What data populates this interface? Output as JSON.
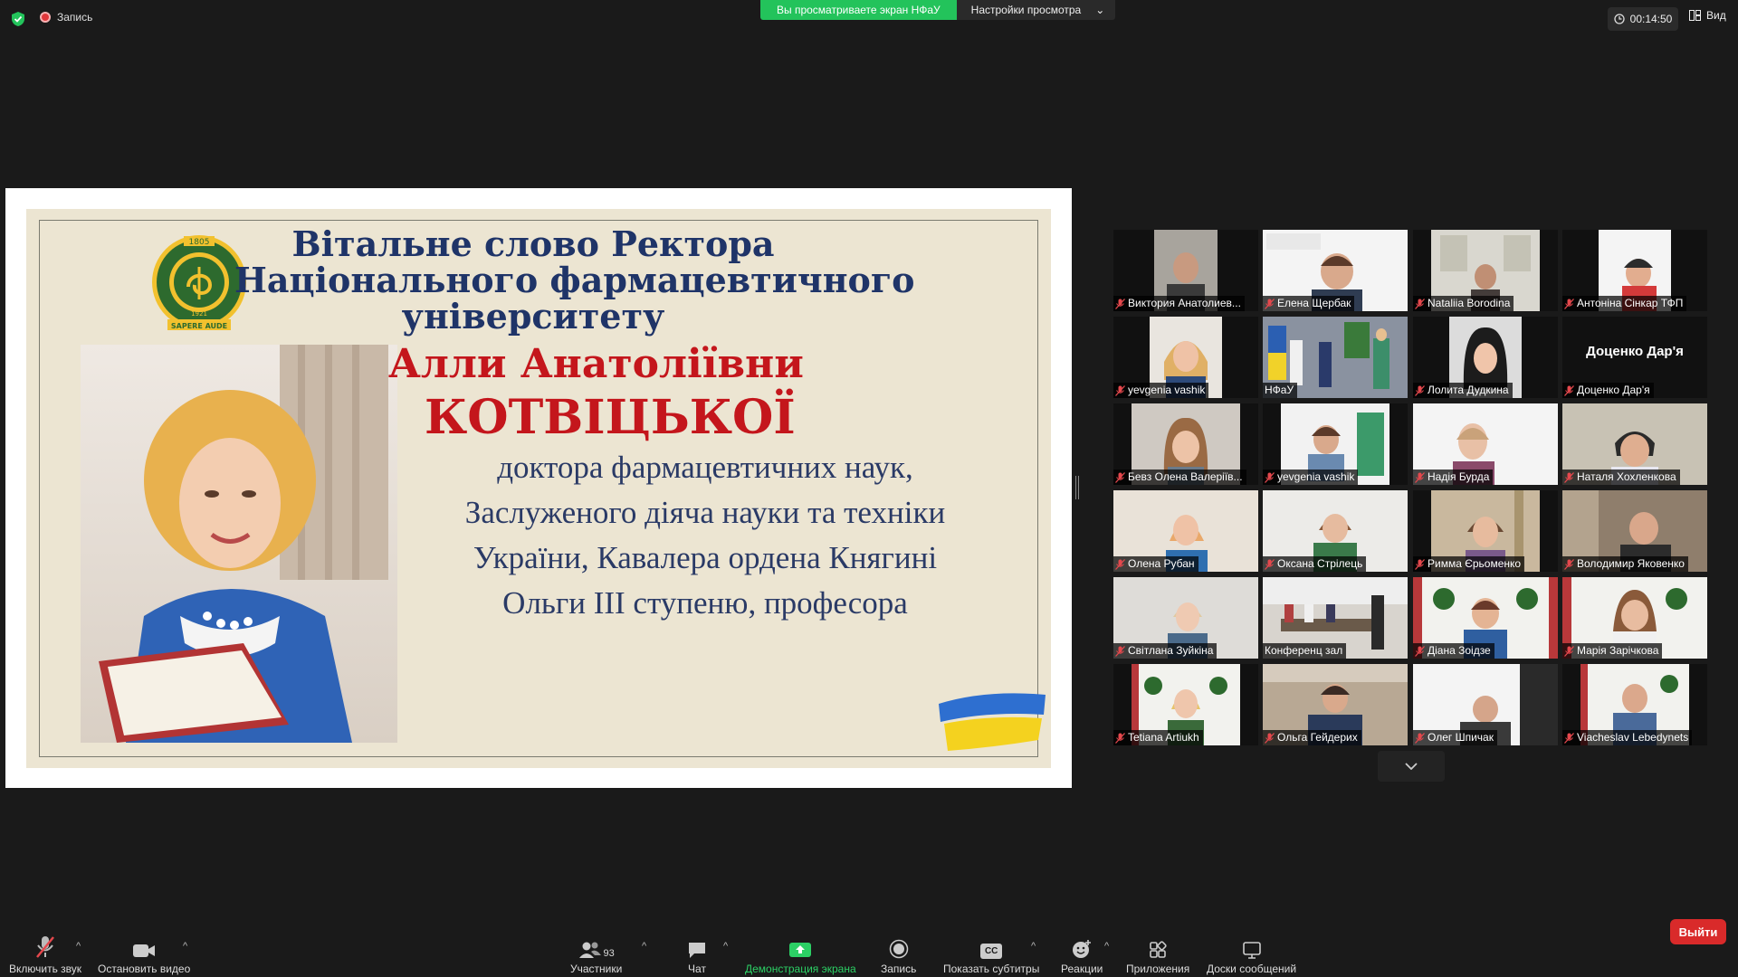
{
  "top": {
    "recording_label": "Запись",
    "viewing_banner": "Вы просматриваете экран НФаУ",
    "view_options": "Настройки просмотра",
    "timer": "00:14:50",
    "view_label": "Вид"
  },
  "slide": {
    "title_1": "Вітальне слово Ректора",
    "title_2": "Національного фармацевтичного",
    "title_3": "університету",
    "name_1": "Алли Анатоліївни",
    "name_2": "КОТВІЦЬКОЇ",
    "desc_1": "доктора фармацевтичних наук,",
    "desc_2": "Заслуженого діяча науки та техніки",
    "desc_3": "України, Кавалера ордена Княгині",
    "desc_4": "Ольги ІІІ ступеню, професора",
    "logo_top": "1805",
    "logo_mid": "1921",
    "logo_motto": "SAPERE AUDE"
  },
  "participants": [
    {
      "name": "Виктория Анатолиев..."
    },
    {
      "name": "Елена Щербак"
    },
    {
      "name": "Nataliia Borodina"
    },
    {
      "name": "Антоніна Сінкар ТФП"
    },
    {
      "name": "yevgenia vashik"
    },
    {
      "name": "НФаУ"
    },
    {
      "name": "Лолита Дудкина"
    },
    {
      "name": "Доценко Дар'я",
      "big": "Доценко Дар'я"
    },
    {
      "name": "Бевз Олена Валеріїв..."
    },
    {
      "name": "yevgenia vashik"
    },
    {
      "name": "Надія Бурда"
    },
    {
      "name": "Наталя Хохленкова"
    },
    {
      "name": "Олена Рубан"
    },
    {
      "name": "Оксана Стрілець"
    },
    {
      "name": "Римма Єрьоменко"
    },
    {
      "name": "Володимир Яковенко"
    },
    {
      "name": "Світлана Зуйкіна"
    },
    {
      "name": "Конференц зал"
    },
    {
      "name": "Діана Зоідзе"
    },
    {
      "name": "Марія Зарічкова"
    },
    {
      "name": "Tetiana Artiukh"
    },
    {
      "name": "Ольга Гейдерих"
    },
    {
      "name": "Олег Шпичак"
    },
    {
      "name": "Viacheslav Lebedynets"
    }
  ],
  "toolbar": {
    "unmute": "Включить звук",
    "stop_video": "Остановить видео",
    "participants": "Участники",
    "participants_count": "93",
    "chat": "Чат",
    "share_screen": "Демонстрация экрана",
    "record": "Запись",
    "captions": "Показать субтитры",
    "captions_icon": "CC",
    "reactions": "Реакции",
    "apps": "Приложения",
    "whiteboards": "Доски сообщений",
    "leave": "Выйти"
  },
  "colors": {
    "share_green": "#23c35b",
    "leave_red": "#d92a2a",
    "active_speaker": "#d9e355",
    "slide_title": "#1f3468",
    "slide_name": "#c4161c"
  }
}
